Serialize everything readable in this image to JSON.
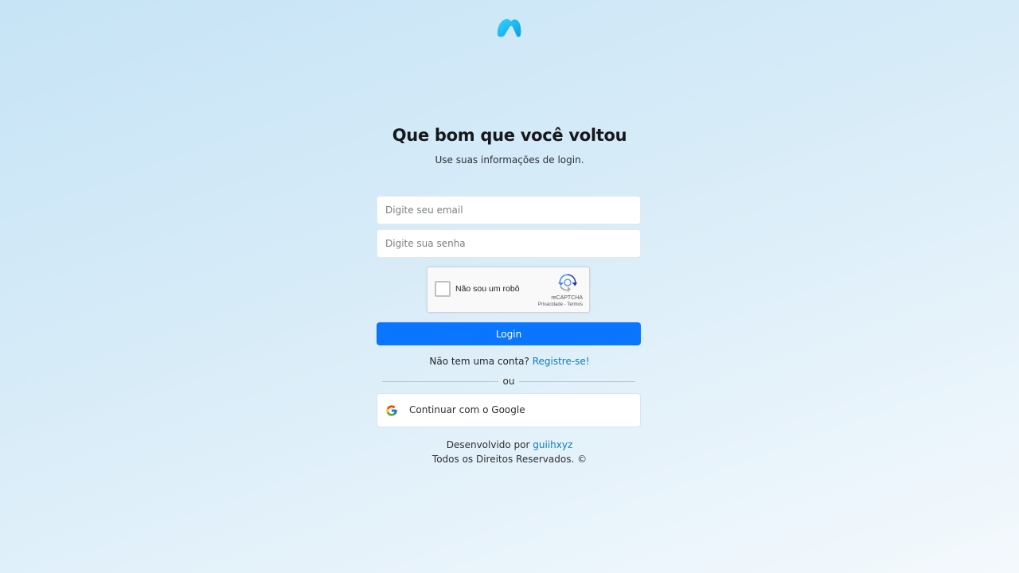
{
  "brand": {
    "logo_icon": "app-logo-icon",
    "accent_color": "#00b8f0"
  },
  "header": {
    "title": "Que bom que você voltou",
    "subtitle": "Use suas informações de login."
  },
  "form": {
    "email_placeholder": "Digite seu email",
    "password_placeholder": "Digite sua senha",
    "login_label": "Login",
    "login_color": "#0a75ff"
  },
  "captcha": {
    "label": "Não sou um robô",
    "brand": "reCAPTCHA",
    "privacy": "Privacidade",
    "separator": " - ",
    "terms": "Termos"
  },
  "signup": {
    "prompt": "Não tem uma conta?",
    "link": "Registre-se!"
  },
  "divider_text": "ou",
  "google": {
    "label": "Continuar com o Google",
    "icon": "google-icon"
  },
  "footer": {
    "developed_by": "Desenvolvido por",
    "author": "guiihxyz",
    "rights": "Todos os Direitos Reservados. ©"
  }
}
